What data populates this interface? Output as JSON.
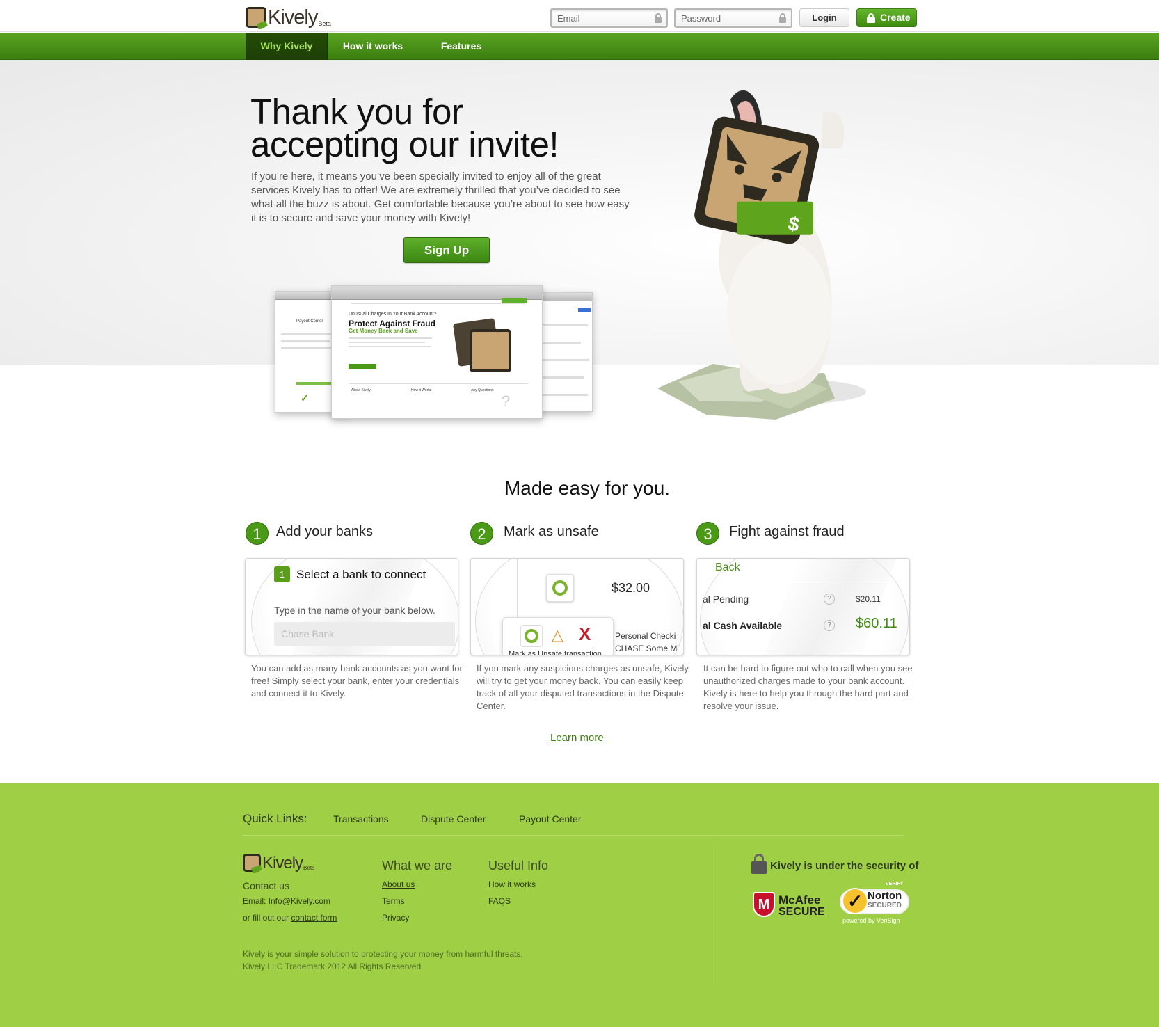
{
  "header": {
    "logo_text": "Kively",
    "logo_beta": "Beta",
    "email_placeholder": "Email",
    "password_placeholder": "Password",
    "login_label": "Login",
    "create_label": "Create"
  },
  "nav": {
    "items": [
      {
        "label": "Why Kively"
      },
      {
        "label": "How it works"
      },
      {
        "label": "Features"
      }
    ]
  },
  "hero": {
    "title_line1": "Thank you for",
    "title_line2": "accepting our invite!",
    "intro": "If you’re here, it means you’ve been specially invited to enjoy all of the great services Kively has to offer!  We are extremely thrilled that you’ve decided to see what all the buzz is about.  Get comfortable because you’re about to see how easy it is to secure and save your money with Kively!",
    "signup_label": "Sign Up",
    "mock": {
      "headline": "Unusual Charges In Your Bank Account?",
      "title": "Protect Against Fraud",
      "subtitle": "Get Money Back and Save",
      "box1": "About Kively",
      "box2": "How it Works",
      "box3": "Any Questions",
      "payout": "Payout Center"
    }
  },
  "how": {
    "heading": "Made easy for you.",
    "steps": [
      {
        "num": "1",
        "title": "Add your banks",
        "card_badge": "1",
        "card_title": "Select a bank to connect",
        "card_hint": "Type in the name of your bank below.",
        "card_input": "Chase Bank",
        "desc": "You can add as many bank accounts as you want for free!  Simply select your bank, enter your credentials and connect it to Kively."
      },
      {
        "num": "2",
        "title": "Mark as unsafe",
        "amount": "$32.00",
        "account1": "Personal Checki",
        "account2": "CHASE Some M",
        "popup_text": "Mark as Unsafe transaction",
        "desc": "If you mark any suspicious charges as unsafe, Kively will try to get your money back.  You can easily keep track of all your disputed transactions in the Dispute Center."
      },
      {
        "num": "3",
        "title": "Fight against fraud",
        "back_label": "Back",
        "row1_label": "al Pending",
        "row1_value": "$20.11",
        "row2_label": "al Cash Available",
        "row2_value": "$60.11",
        "help": "?",
        "desc": "It can be hard to figure out who to call when you see unauthorized charges made to your bank account.  Kively is here to help you through the hard part and resolve your issue."
      }
    ],
    "learn_more": "Learn more"
  },
  "footer": {
    "quick_links_label": "Quick Links:",
    "quick_links": [
      "Transactions",
      "Dispute Center",
      "Payout Center"
    ],
    "logo_text": "Kively",
    "logo_beta": "Beta",
    "contact_heading": "Contact us",
    "email_line": "Email: Info@Kively.com",
    "contact_prefix": "or fill out our",
    "contact_link": "contact form",
    "what_heading": "What we are",
    "what_links": [
      "About us",
      "Terms",
      "Privacy"
    ],
    "useful_heading": "Useful Info",
    "useful_links": [
      "How it works",
      "FAQS"
    ],
    "security_title": "Kively is under the security of",
    "mcafee_line1": "McAfee",
    "mcafee_line2": "SECURE",
    "norton_verify": "VERIFY",
    "norton_line1": "Norton",
    "norton_line2": "SECURED",
    "norton_powered": "powered by VeriSign",
    "tagline": "Kively is your simple solution to protecting your money from harmful threats.",
    "copyright": "Kively LLC Trademark 2012 All Rights Reserved"
  },
  "colors": {
    "brand_green": "#4a9a18",
    "footer_green": "#9fcf45",
    "nav_active_text": "#a7e35a"
  }
}
